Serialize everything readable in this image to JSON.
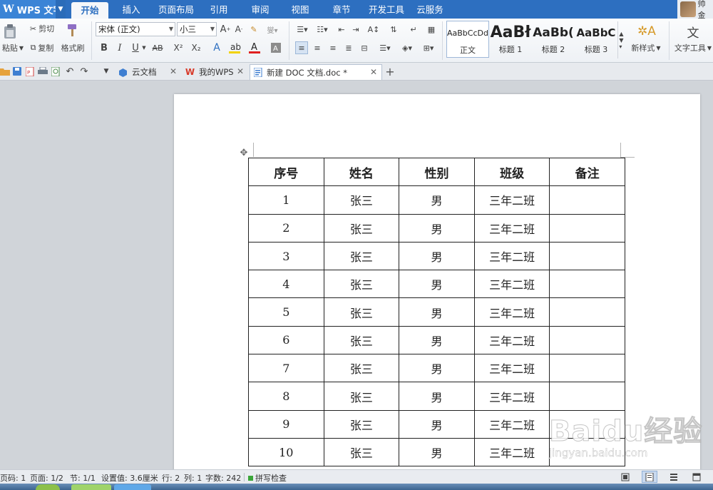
{
  "app": {
    "name": "WPS 文字",
    "user_name": "帅金"
  },
  "menu_tabs": [
    {
      "label": "开始",
      "active": true
    },
    {
      "label": "插入"
    },
    {
      "label": "页面布局"
    },
    {
      "label": "引用"
    },
    {
      "label": "审阅"
    },
    {
      "label": "视图"
    },
    {
      "label": "章节"
    },
    {
      "label": "开发工具"
    },
    {
      "label": "云服务"
    }
  ],
  "ribbon": {
    "paste_label": "粘贴",
    "cut_label": "剪切",
    "copy_label": "复制",
    "format_painter_label": "格式刷",
    "font_name": "宋体 (正文)",
    "font_size": "小三",
    "bold": "B",
    "italic": "I",
    "underline": "U",
    "strike": "AB",
    "superscript": "X²",
    "subscript": "X₂",
    "styles": [
      {
        "sample": "AaBbCcDd",
        "name": "正文"
      },
      {
        "sample": "AaBł",
        "name": "标题 1"
      },
      {
        "sample": "AaBb(",
        "name": "标题 2"
      },
      {
        "sample": "AaBbC",
        "name": "标题 3"
      }
    ],
    "new_style_label": "新样式",
    "text_tools_label": "文字工具"
  },
  "doc_tabs": [
    {
      "label": "云文档",
      "icon": "cloud-icon"
    },
    {
      "label": "我的WPS",
      "icon": "wps-icon"
    },
    {
      "label": "新建 DOC 文档.doc *",
      "icon": "doc-icon",
      "active": true
    }
  ],
  "table": {
    "headers": [
      "序号",
      "姓名",
      "性别",
      "班级",
      "备注"
    ],
    "rows": [
      [
        "1",
        "张三",
        "男",
        "三年二班",
        ""
      ],
      [
        "2",
        "张三",
        "男",
        "三年二班",
        ""
      ],
      [
        "3",
        "张三",
        "男",
        "三年二班",
        ""
      ],
      [
        "4",
        "张三",
        "男",
        "三年二班",
        ""
      ],
      [
        "5",
        "张三",
        "男",
        "三年二班",
        ""
      ],
      [
        "6",
        "张三",
        "男",
        "三年二班",
        ""
      ],
      [
        "7",
        "张三",
        "男",
        "三年二班",
        ""
      ],
      [
        "8",
        "张三",
        "男",
        "三年二班",
        ""
      ],
      [
        "9",
        "张三",
        "男",
        "三年二班",
        ""
      ],
      [
        "10",
        "张三",
        "男",
        "三年二班",
        ""
      ]
    ]
  },
  "status": {
    "page_num": "页码: 1",
    "pages": "页面: 1/2",
    "section": "节: 1/1",
    "setting": "设置值: 3.6厘米",
    "row": "行: 2",
    "col": "列: 1",
    "words": "字数: 242",
    "spell": "拼写检查"
  },
  "watermark": {
    "main": "Baidu经验",
    "sub": "jingyan.baidu.com"
  },
  "colors": {
    "menubar": "#2d6fc0",
    "accent": "#3b84d6",
    "font_color_bar": "#e02020",
    "highlight_bar": "#f2d200"
  }
}
